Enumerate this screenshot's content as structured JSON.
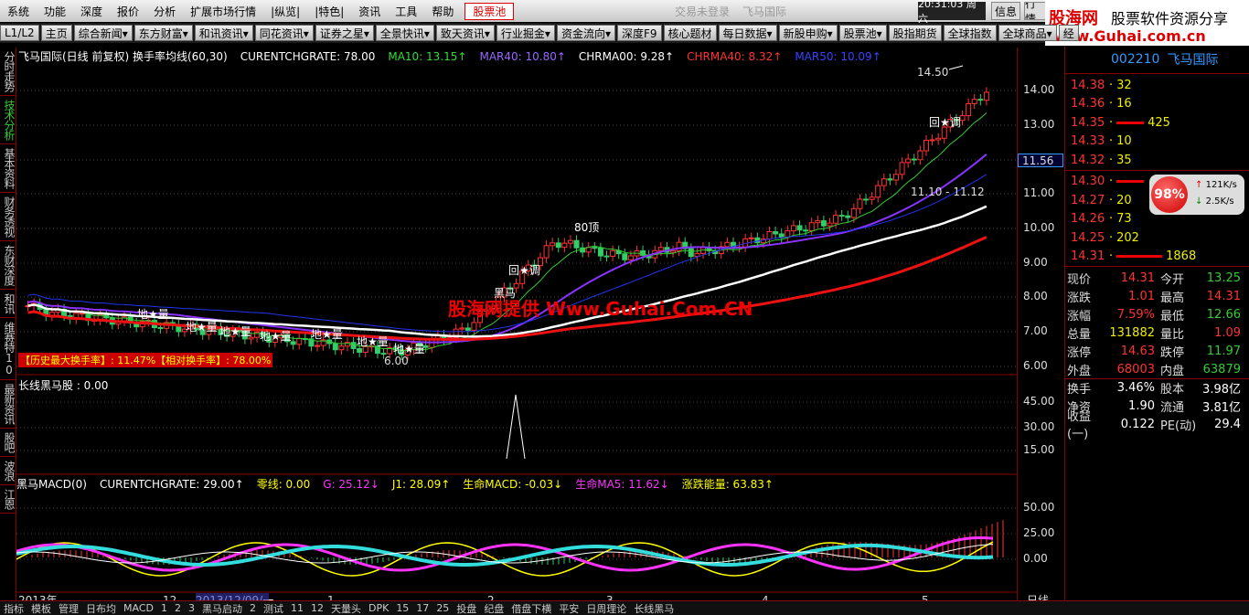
{
  "menu": {
    "items": [
      "系统",
      "功能",
      "深度",
      "报价",
      "分析",
      "扩展市场行情",
      "|纵览|",
      "|特色|",
      "资讯",
      "工具",
      "帮助"
    ],
    "pool_label": "股票池",
    "center": [
      "交易未登录",
      "飞马国际"
    ],
    "clock": "20:31:03 周六",
    "info_btn": "信息",
    "trade_btn": "行情"
  },
  "logo": {
    "brand": "股海网",
    "slogan": "股票软件资源分享",
    "url": "www.Guhai.com.cn"
  },
  "toolbar": {
    "level": "L1/L2",
    "items": [
      "主页",
      "综合新闻▾",
      "东方财富▾",
      "和讯资讯▾",
      "同花资讯▾",
      "证券之星▾",
      "全景快讯▾",
      "致天资讯▾",
      "行业掘金▾",
      "资金流向▾",
      "深度F9",
      "核心题材",
      "每日数据▾",
      "新股申购▾",
      "股票池▾",
      "股指期货",
      "全球指数",
      "全球商品▾",
      "经"
    ]
  },
  "left_tabs": [
    {
      "label": "分时走势",
      "active": false
    },
    {
      "label": "技术分析",
      "active": true
    },
    {
      "label": "基本资料",
      "active": false
    },
    {
      "label": "财务透视",
      "active": false
    },
    {
      "label": "东财深度",
      "active": false
    },
    {
      "label": "和讯",
      "active": false
    },
    {
      "label": "维赛特10",
      "active": false
    },
    {
      "label": "最新资讯",
      "active": false
    },
    {
      "label": "股吧",
      "active": false
    },
    {
      "label": "波浪",
      "active": false
    },
    {
      "label": "江恩",
      "active": false
    }
  ],
  "main_header": {
    "title": "飞马国际(日线 前复权) 换手率均线(60,30)",
    "items": [
      {
        "t": "CURENTCHGRATE: 78.00",
        "c": "#ffffff"
      },
      {
        "t": "MA10: 13.15↑",
        "c": "#33dd33"
      },
      {
        "t": "MAR40: 10.80↑",
        "c": "#9966ff"
      },
      {
        "t": "CHRMA00: 9.28↑",
        "c": "#ffffff"
      },
      {
        "t": "CHRMA40: 8.32↑",
        "c": "#ff3333"
      },
      {
        "t": "MAR50: 10.09↑",
        "c": "#3344ff"
      }
    ]
  },
  "annotations": {
    "high": "14.50",
    "low": "6.00",
    "range": "11.10 - 11.12",
    "top80": "80顶",
    "callback1": "回★调",
    "callback2": "回★调",
    "blackhorse": "黑马",
    "stars": [
      "地★量",
      "地★量",
      "地★量",
      "地★量",
      "地★量",
      "地★量",
      "地★量"
    ],
    "history": "【历史最大换手率】: 11.47%【相对换手率】: 78.00%",
    "price_marker": "11.56"
  },
  "watermark": "股海网提供 Www.Guhai.Com.CN",
  "panel2_header": "长线黑马股 : 0.00",
  "panel3_header": {
    "title": "黑马MACD(0)",
    "items": [
      {
        "t": "CURENTCHGRATE: 29.00↑",
        "c": "#ffffff"
      },
      {
        "t": "零线: 0.00",
        "c": "#ffff00"
      },
      {
        "t": "G: 25.12↓",
        "c": "#ff33ff"
      },
      {
        "t": "J1: 28.09↑",
        "c": "#ffff00"
      },
      {
        "t": "生命MACD: -0.03↓",
        "c": "#ffff00"
      },
      {
        "t": "生命MA5: 11.62↓",
        "c": "#ff33ff"
      },
      {
        "t": "涨跌能量: 63.83↑",
        "c": "#ffff00"
      }
    ]
  },
  "y_axis_main": [
    "14.00",
    "13.00",
    "12.00",
    "11.00",
    "10.00",
    "9.00",
    "8.00",
    "7.00",
    "6.00"
  ],
  "y_axis_p2": [
    "45.00",
    "30.00",
    "15.00"
  ],
  "y_axis_p3": [
    "50.00",
    "25.00",
    "0.00"
  ],
  "x_axis": {
    "labels": [
      "2013年",
      "12",
      "2013/12/09/一",
      "1",
      "2",
      "3",
      "4",
      "5"
    ],
    "right": "日线"
  },
  "bottom_tabs": [
    "指标",
    "模板",
    "管理",
    "日布均",
    "MACD",
    "1",
    "2",
    "3",
    "黑马启动",
    "2",
    "测试",
    "11",
    "12",
    "天量头",
    "DPK",
    "15",
    "17",
    "25",
    "投盘",
    "纪盘",
    "借盘下横",
    "平安",
    "日周理论",
    "长线黑马"
  ],
  "quote": {
    "code": "002210",
    "name": "飞马国际",
    "asks": [
      {
        "p": "14.38",
        "v": "32",
        "bar": 0
      },
      {
        "p": "14.36",
        "v": "16",
        "bar": 0
      },
      {
        "p": "14.35",
        "v": "425",
        "bar": 60
      },
      {
        "p": "14.33",
        "v": "10",
        "bar": 0
      },
      {
        "p": "14.32",
        "v": "35",
        "bar": 0
      }
    ],
    "bids": [
      {
        "p": "14.31",
        "v": "1868",
        "bar": 100
      },
      {
        "p": "14.30",
        "v": "",
        "bar": 60
      },
      {
        "p": "14.27",
        "v": "20",
        "bar": 0
      },
      {
        "p": "14.26",
        "v": "73",
        "bar": 0
      },
      {
        "p": "14.25",
        "v": "202",
        "bar": 0
      }
    ],
    "gauge": {
      "pct": "98%",
      "up": "121K/s",
      "down": "2.5K/s"
    },
    "rows": [
      {
        "k": "现价",
        "v": "14.31",
        "vc": "red",
        "k2": "今开",
        "v2": "13.25",
        "v2c": "green"
      },
      {
        "k": "涨跌",
        "v": "1.01",
        "vc": "red",
        "k2": "最高",
        "v2": "14.31",
        "v2c": "red"
      },
      {
        "k": "涨幅",
        "v": "7.59%",
        "vc": "red",
        "k2": "最低",
        "v2": "12.66",
        "v2c": "green"
      },
      {
        "k": "总量",
        "v": "131882",
        "vc": "yellow",
        "k2": "量比",
        "v2": "1.09",
        "v2c": "red"
      },
      {
        "k": "涨停",
        "v": "14.63",
        "vc": "red",
        "k2": "跌停",
        "v2": "11.97",
        "v2c": "green"
      },
      {
        "k": "外盘",
        "v": "68003",
        "vc": "red",
        "k2": "内盘",
        "v2": "63879",
        "v2c": "green"
      },
      {
        "k": "换手",
        "v": "3.46%",
        "vc": "white",
        "k2": "股本",
        "v2": "3.98亿",
        "v2c": "white"
      },
      {
        "k": "净资",
        "v": "1.90",
        "vc": "white",
        "k2": "流通",
        "v2": "3.81亿",
        "v2c": "white"
      },
      {
        "k": "收益(一)",
        "v": "0.122",
        "vc": "white",
        "k2": "PE(动)",
        "v2": "29.4",
        "v2c": "white"
      }
    ]
  }
}
